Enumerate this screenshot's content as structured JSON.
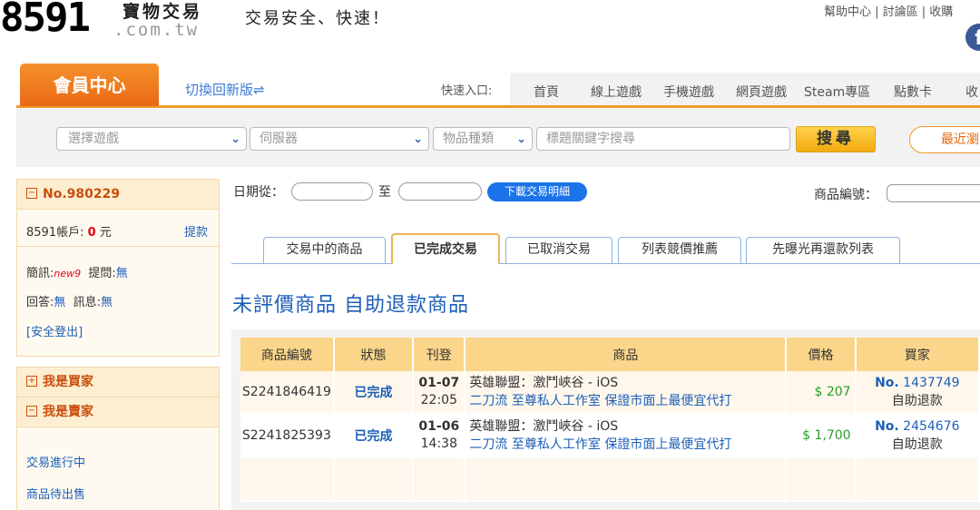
{
  "header": {
    "logo_number": "8591",
    "logo_chinese": "寶物交易",
    "logo_domain": ".com.tw",
    "slogan": "交易安全、快速！",
    "top_links": "幫助中心 | 討論區 | 收購",
    "facebook_glyph": "f"
  },
  "nav": {
    "member_center": "會員中心",
    "switch_label": "切換回新版⇌",
    "quick_label": "快速入口:",
    "quick_links": [
      "首頁",
      "線上遊戲",
      "手機遊戲",
      "網頁遊戲",
      "Steam專區",
      "點數卡",
      "收"
    ]
  },
  "search": {
    "game_placeholder": "選擇遊戲",
    "server_placeholder": "伺服器",
    "item_type_placeholder": "物品種類",
    "keyword_placeholder": "標題關鍵字搜尋",
    "search_button": "搜尋",
    "recent_button": "最近瀏"
  },
  "sidebar": {
    "account_no": "No.980229",
    "balance_label": "8591帳戶:",
    "balance_value": "0",
    "balance_unit": "元",
    "withdraw": "提款",
    "messages_label": "簡訊:",
    "messages_new": "new9",
    "questions_label": "提問:",
    "questions_value": "無",
    "replies_label": "回答:",
    "replies_value": "無",
    "notices_label": "訊息:",
    "notices_value": "無",
    "logout": "[安全登出]",
    "buyer_section": "我是買家",
    "seller_section": "我是賣家",
    "seller_items": [
      "交易進行中",
      "商品待出售"
    ]
  },
  "filters": {
    "date_from": "日期從：",
    "date_to": "至",
    "download_button": "下載交易明細",
    "product_no_label": "商品編號："
  },
  "tabs": [
    "交易中的商品",
    "已完成交易",
    "已取消交易",
    "列表競價推薦",
    "先曝光再還款列表"
  ],
  "active_tab": "已完成交易",
  "section_title": "未評價商品 自助退款商品",
  "table": {
    "headers": [
      "商品編號",
      "狀態",
      "刊登",
      "商品",
      "價格",
      "買家"
    ],
    "rows": [
      {
        "id": "S2241846419",
        "status": "已完成",
        "date": "01-07",
        "time": "22:05",
        "game": "英雄聯盟：激鬥峽谷 - iOS",
        "title": "二刀流 至尊私人工作室 保證市面上最便宜代打",
        "price": "$ 207",
        "buyer_no_label": "No.",
        "buyer_no": "1437749",
        "refund": "自助退款"
      },
      {
        "id": "S2241825393",
        "status": "已完成",
        "date": "01-06",
        "time": "14:38",
        "game": "英雄聯盟：激鬥峽谷 - iOS",
        "title": "二刀流 至尊私人工作室 保證市面上最便宜代打",
        "price": "$ 1,700",
        "buyer_no_label": "No.",
        "buyer_no": "2454676",
        "refund": "自助退款"
      }
    ]
  },
  "colors": {
    "brand_orange": "#f19a2a",
    "link_blue": "#1d5fb8",
    "price_green": "#2a9d2a",
    "alert_red": "#e60012"
  }
}
